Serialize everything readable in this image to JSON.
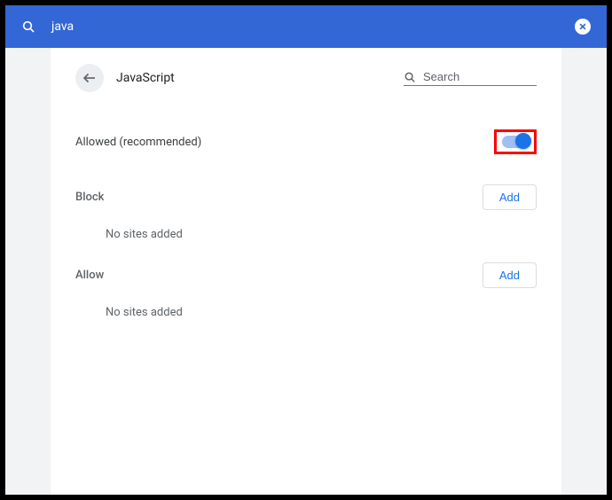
{
  "topbar": {
    "search_query": "java"
  },
  "page": {
    "title": "JavaScript",
    "search_placeholder": "Search"
  },
  "main_toggle": {
    "label": "Allowed (recommended)",
    "on": true
  },
  "sections": {
    "block": {
      "title": "Block",
      "add_label": "Add",
      "empty": "No sites added"
    },
    "allow": {
      "title": "Allow",
      "add_label": "Add",
      "empty": "No sites added"
    }
  },
  "colors": {
    "accent": "#1a73e8",
    "topbar": "#3367d6",
    "highlight": "#ff0000"
  }
}
